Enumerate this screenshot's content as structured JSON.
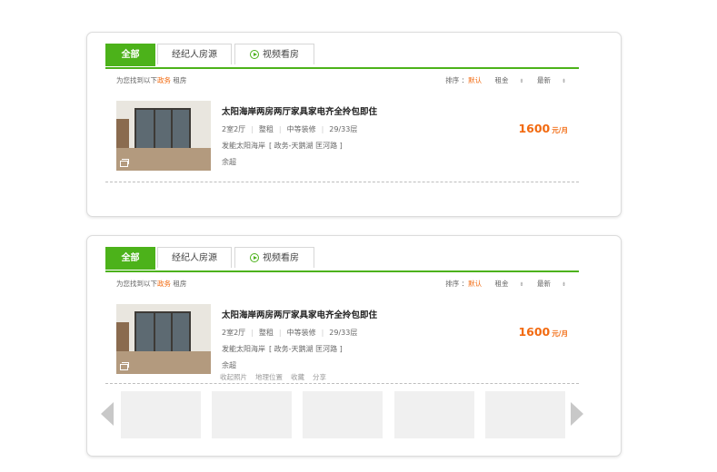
{
  "tabs": [
    {
      "label": "全部"
    },
    {
      "label": "经纪人房源"
    },
    {
      "label": "视频看房"
    }
  ],
  "result_info": {
    "prefix": "为您找到以下",
    "district": "政务",
    "suffix": "租房"
  },
  "sort": {
    "label": "排序",
    "options": [
      "默认",
      "租金",
      "最新"
    ]
  },
  "listing": {
    "title": "太阳海岸两房两厅家具家电齐全拎包即住",
    "layout": "2室2厅",
    "rent_type": "整租",
    "decoration": "中等装修",
    "floor": "29/33层",
    "community": "发能太阳海岸",
    "area": "[ 政务-天鹅湖 匡河路 ]",
    "agent": "余超",
    "price": "1600",
    "price_unit": "元/月"
  },
  "extra_links": [
    "收起照片",
    "地理位置",
    "收藏",
    "分享"
  ],
  "icons": {
    "video_tab": "play-circle-icon",
    "photo": "gallery-icon",
    "sort_arrow": "down-arrow-icon",
    "prev": "chevron-left-icon",
    "next": "chevron-right-icon"
  },
  "colors": {
    "accent": "#4cb21a",
    "highlight": "#f26a10"
  }
}
